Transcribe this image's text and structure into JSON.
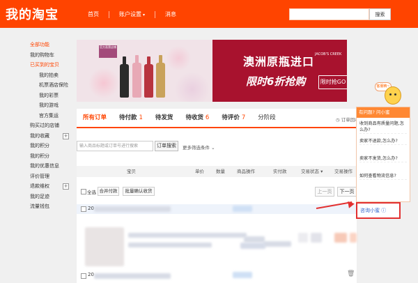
{
  "header": {
    "logo": "我的淘宝",
    "nav": [
      {
        "label": "首页",
        "caret": false
      },
      {
        "label": "账户设置",
        "caret": true
      },
      {
        "label": "消息",
        "caret": false
      }
    ],
    "search_button": "搜索"
  },
  "sidebar": {
    "items": [
      {
        "label": "全部功能",
        "type": "head"
      },
      {
        "label": "我的购物车",
        "type": "normal"
      },
      {
        "label": "已买到的宝贝",
        "type": "active"
      },
      {
        "label": "我的拍卖",
        "type": "sub"
      },
      {
        "label": "机票酒店保险",
        "type": "sub"
      },
      {
        "label": "我的彩票",
        "type": "sub"
      },
      {
        "label": "我的游戏",
        "type": "sub"
      },
      {
        "label": "官方集运",
        "type": "sub"
      },
      {
        "label": "购买过的店铺",
        "type": "normal"
      },
      {
        "label": "我的收藏",
        "type": "normal",
        "toggle": "+"
      },
      {
        "label": "我的积分",
        "type": "normal"
      },
      {
        "label": "我的积分",
        "type": "normal"
      },
      {
        "label": "我的优惠信息",
        "type": "normal"
      },
      {
        "label": "评价管理",
        "type": "normal"
      },
      {
        "label": "退款维权",
        "type": "normal",
        "toggle": "+"
      },
      {
        "label": "我的足迹",
        "type": "normal"
      },
      {
        "label": "流量钱包",
        "type": "normal"
      }
    ]
  },
  "banner": {
    "tag": "官方直营店铺",
    "title": "澳洲原瓶进口",
    "subtitle": "限时6折抢购",
    "brand": "JACOB'S CREEK",
    "button": "限时抢GO"
  },
  "tabs": [
    {
      "label": "所有订单",
      "count": "",
      "active": true
    },
    {
      "label": "待付款",
      "count": "1",
      "active": false
    },
    {
      "label": "待发货",
      "count": "",
      "active": false
    },
    {
      "label": "待收货",
      "count": "6",
      "active": false
    },
    {
      "label": "待评价",
      "count": "7",
      "active": false
    },
    {
      "label": "分阶段",
      "count": "",
      "active": false
    }
  ],
  "recycle_link": "订单回收站",
  "order_search": {
    "placeholder": "输入商品标题或订单号进行搜索",
    "button": "订单搜索",
    "more": "更多筛选条件"
  },
  "table_headers": [
    "宝贝",
    "单价",
    "数量",
    "商品操作",
    "实付款",
    "交易状态",
    "交易操作"
  ],
  "batch": {
    "select_all": "全选",
    "merge_pay": "合并付款",
    "batch_confirm": "批量确认收货",
    "prev": "上一页",
    "next": "下一页"
  },
  "order_date_prefix": "20",
  "help": {
    "bubble": "客服精~",
    "title": "有问题? 问小蜜",
    "questions": [
      "收到商品有质量问题,怎么办?",
      "卖家不退款,怎么办?",
      "卖家不发货,怎么办?",
      "如何查看物流信息?"
    ],
    "consult": "咨询小蜜"
  }
}
